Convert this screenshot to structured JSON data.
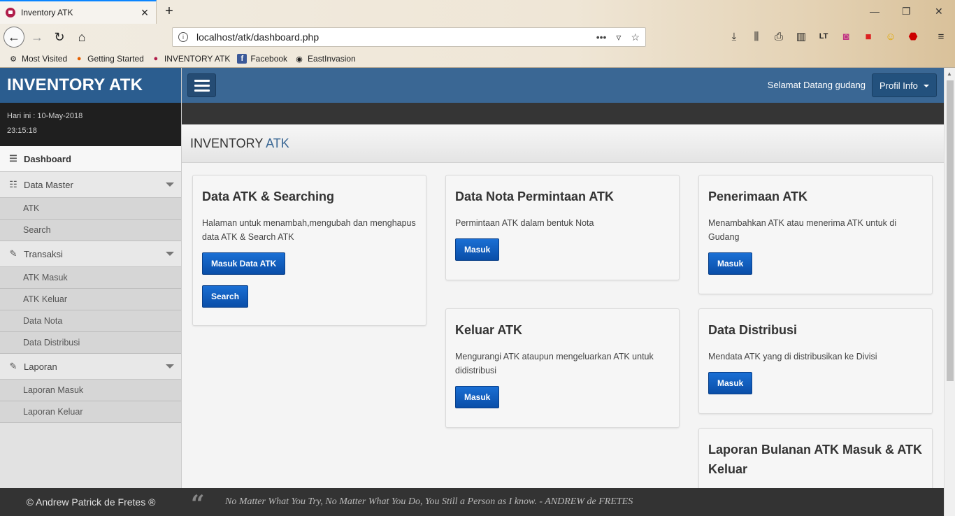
{
  "browser": {
    "tab_title": "Inventory ATK",
    "url": "localhost/atk/dashboard.php",
    "bookmarks": [
      "Most Visited",
      "Getting Started",
      "INVENTORY ATK",
      "Facebook",
      "EastInvasion"
    ]
  },
  "sidebar": {
    "brand": "INVENTORY ATK",
    "date": "Hari ini : 10-May-2018",
    "time": "23:15:18",
    "dashboard": "Dashboard",
    "data_master": "Data Master",
    "data_master_items": [
      "ATK",
      "Search"
    ],
    "transaksi": "Transaksi",
    "transaksi_items": [
      "ATK Masuk",
      "ATK Keluar",
      "Data Nota",
      "Data Distribusi"
    ],
    "laporan": "Laporan",
    "laporan_items": [
      "Laporan Masuk",
      "Laporan Keluar"
    ]
  },
  "topbar": {
    "welcome": "Selamat Datang gudang",
    "profile": "Profil Info"
  },
  "page": {
    "title_main": "INVENTORY",
    "title_accent": "ATK"
  },
  "cards": {
    "data_atk": {
      "title": "Data ATK & Searching",
      "desc": "Halaman untuk menambah,mengubah dan menghapus data ATK & Search ATK",
      "btn1": "Masuk Data ATK",
      "btn2": "Search"
    },
    "nota": {
      "title": "Data Nota Permintaan ATK",
      "desc": "Permintaan ATK dalam bentuk Nota",
      "btn": "Masuk"
    },
    "keluar": {
      "title": "Keluar ATK",
      "desc": "Mengurangi ATK ataupun mengeluarkan ATK untuk didistribusi",
      "btn": "Masuk"
    },
    "penerimaan": {
      "title": "Penerimaan ATK",
      "desc": "Menambahkan ATK atau menerima ATK untuk di Gudang",
      "btn": "Masuk"
    },
    "distribusi": {
      "title": "Data Distribusi",
      "desc": "Mendata ATK yang di distribusikan ke Divisi",
      "btn": "Masuk"
    },
    "laporan": {
      "title": "Laporan Bulanan ATK Masuk & ATK Keluar"
    }
  },
  "footer": {
    "copyright": "© Andrew Patrick de Fretes ®",
    "quote": "No Matter What You Try, No Matter What You Do, You Still a Person as I know. - ANDREW de FRETES"
  },
  "colors": {
    "brand": "#2b5d8f",
    "topbar": "#3a6794",
    "button": "#0a4ea8"
  }
}
